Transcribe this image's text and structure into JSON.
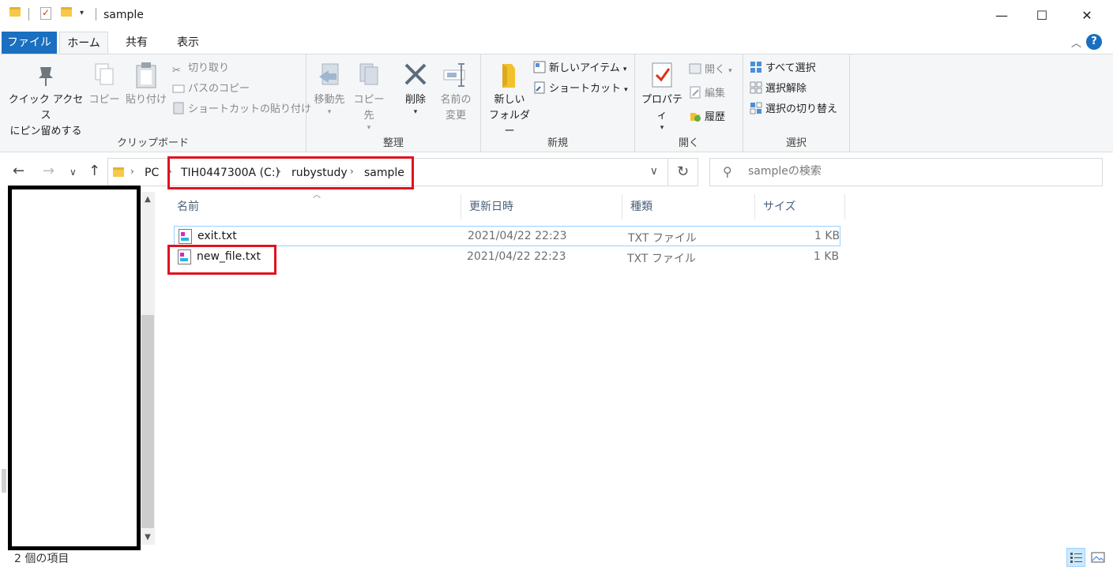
{
  "window": {
    "title": "sample",
    "minimize": "—",
    "maximize": "☐",
    "close": "✕"
  },
  "tabs": {
    "file": "ファイル",
    "home": "ホーム",
    "share": "共有",
    "view": "表示",
    "help": "?"
  },
  "ribbon": {
    "clipboard": {
      "label": "クリップボード",
      "pin_line1": "クイック アクセス",
      "pin_line2": "にピン留めする",
      "copy": "コピー",
      "paste": "貼り付け",
      "cut": "切り取り",
      "copy_path": "パスのコピー",
      "paste_shortcut": "ショートカットの貼り付け"
    },
    "organize": {
      "label": "整理",
      "move_to": "移動先",
      "copy_to": "コピー先",
      "delete": "削除",
      "rename_line1": "名前の",
      "rename_line2": "変更"
    },
    "new": {
      "label": "新規",
      "new_folder_line1": "新しい",
      "new_folder_line2": "フォルダー",
      "new_item": "新しいアイテム",
      "shortcut": "ショートカット"
    },
    "open": {
      "label": "開く",
      "properties": "プロパティ",
      "open": "開く",
      "edit": "編集",
      "history": "履歴"
    },
    "select": {
      "label": "選択",
      "select_all": "すべて選択",
      "select_none": "選択解除",
      "invert": "選択の切り替え"
    }
  },
  "address": {
    "crumbs": [
      "PC",
      "TIH0447300A (C:)",
      "rubystudy",
      "sample"
    ],
    "search_placeholder": "sampleの検索"
  },
  "columns": {
    "name": "名前",
    "date": "更新日時",
    "type": "種類",
    "size": "サイズ"
  },
  "files": [
    {
      "name": "exit.txt",
      "date": "2021/04/22 22:23",
      "type": "TXT ファイル",
      "size": "1 KB",
      "selected": true
    },
    {
      "name": "new_file.txt",
      "date": "2021/04/22 22:23",
      "type": "TXT ファイル",
      "size": "1 KB",
      "selected": false
    }
  ],
  "status": {
    "item_count": "2 個の項目"
  },
  "colors": {
    "accent": "#1a6fc0",
    "highlight": "#e0121f",
    "selection_border": "#99d1ff"
  }
}
